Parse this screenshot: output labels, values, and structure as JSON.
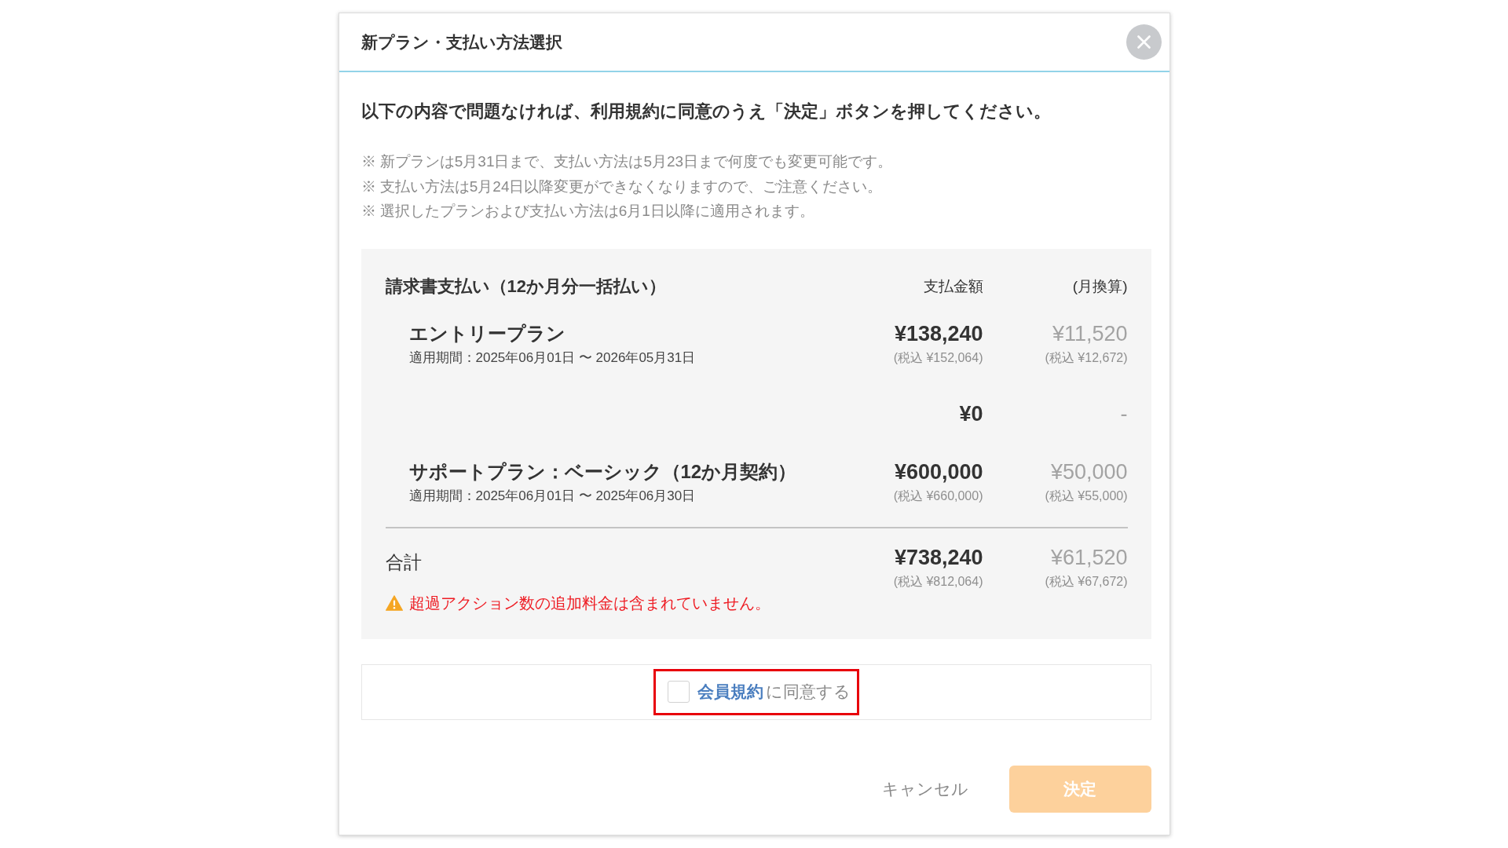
{
  "dialog": {
    "title": "新プラン・支払い方法選択"
  },
  "instruction": "以下の内容で問題なければ、利用規約に同意のうえ「決定」ボタンを押してください。",
  "notes": [
    "※ 新プランは5月31日まで、支払い方法は5月23日まで何度でも変更可能です。",
    "※ 支払い方法は5月24日以降変更ができなくなりますので、ご注意ください。",
    "※ 選択したプランおよび支払い方法は6月1日以降に適用されます。"
  ],
  "summary": {
    "title": "請求書支払い（12か月分一括払い）",
    "columns": [
      "支払金額",
      "(月換算)"
    ],
    "rows": [
      {
        "name": "エントリープラン",
        "period": "適用期間：2025年06月01日 〜 2026年05月31日",
        "amount": "¥138,240",
        "amount_tax": "(税込 ¥152,064)",
        "monthly": "¥11,520",
        "monthly_tax": "(税込 ¥12,672)"
      },
      {
        "amount": "¥0",
        "monthly": "-"
      },
      {
        "name": "サポートプラン：ベーシック（12か月契約）",
        "period": "適用期間：2025年06月01日 〜 2025年06月30日",
        "amount": "¥600,000",
        "amount_tax": "(税込 ¥660,000)",
        "monthly": "¥50,000",
        "monthly_tax": "(税込 ¥55,000)"
      }
    ],
    "total": {
      "label": "合計",
      "amount": "¥738,240",
      "amount_tax": "(税込 ¥812,064)",
      "monthly": "¥61,520",
      "monthly_tax": "(税込 ¥67,672)"
    },
    "warning": "超過アクション数の追加料金は含まれていません。"
  },
  "agreement": {
    "checked": false,
    "highlighted": true,
    "link": "会員規約",
    "text": "に同意する"
  },
  "buttons": [
    {
      "kind": "cancel",
      "label": "キャンセル"
    },
    {
      "kind": "confirm",
      "label": "決定",
      "disabled": true
    }
  ]
}
